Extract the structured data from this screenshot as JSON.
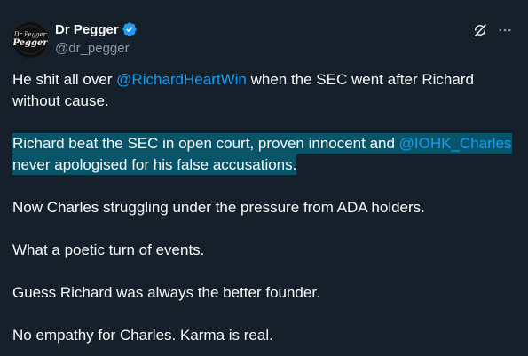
{
  "author": {
    "display_name": "Dr Pegger",
    "handle": "@dr_pegger",
    "avatar_text": "Dr Pegger"
  },
  "body": {
    "p1": {
      "pre": "He shit all over ",
      "mention": "@RichardHeartWin",
      "post": " when the SEC went after Richard without cause."
    },
    "p2": {
      "pre": "Richard beat the SEC in open court, proven innocent and ",
      "mention": "@IOHK_Charles",
      "post": " never apologised for his false accusations."
    },
    "p3": "Now Charles struggling under the pressure from ADA holders.",
    "p4": "What a poetic turn of events.",
    "p5": "Guess Richard was always the better founder.",
    "p6": "No empathy for Charles. Karma is real."
  },
  "icons": {
    "verified": "verified-badge-icon",
    "grok": "grok-icon",
    "more": "more-options-icon"
  },
  "colors": {
    "background": "#15202b",
    "text": "#f7f9f9",
    "muted": "#8b98a5",
    "link": "#1d9bf0",
    "highlight": "#08556a"
  }
}
